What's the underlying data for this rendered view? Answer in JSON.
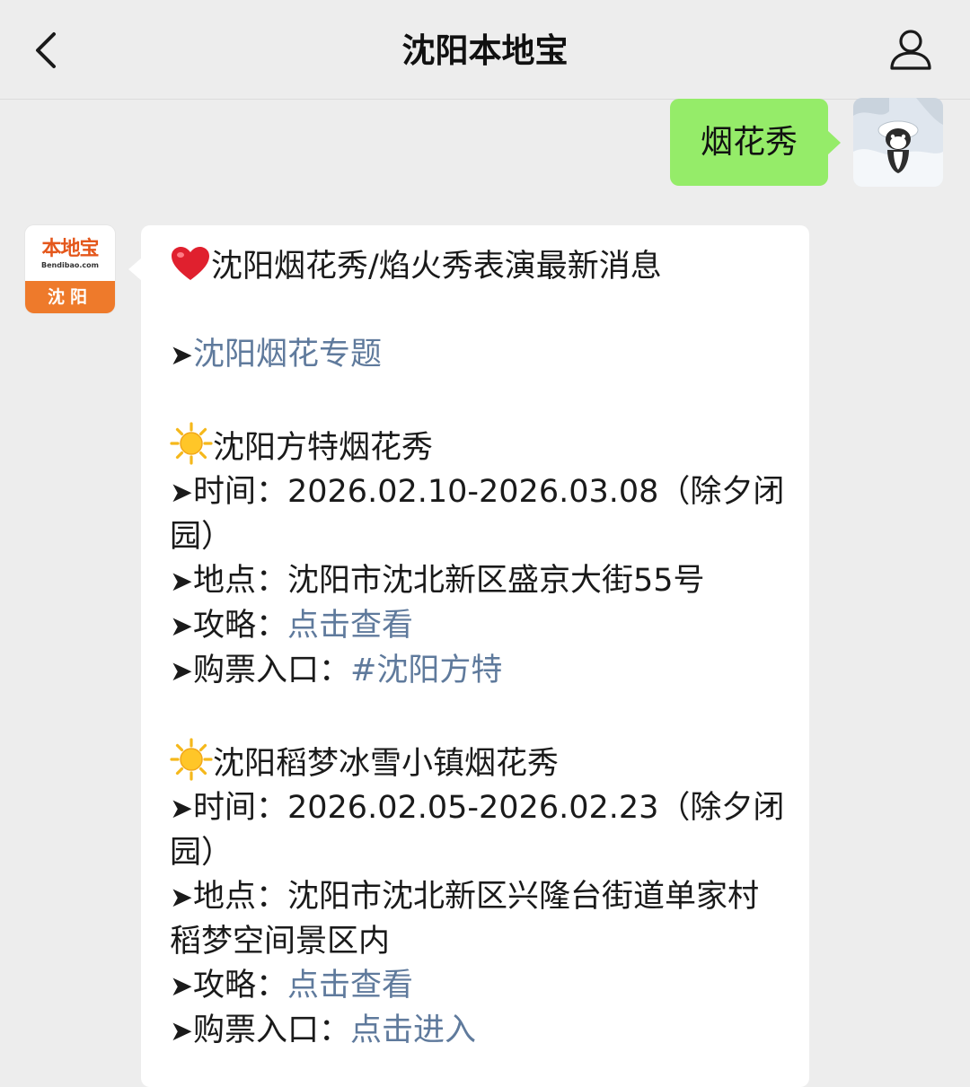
{
  "header": {
    "title": "沈阳本地宝"
  },
  "outgoing": {
    "text": "烟花秀"
  },
  "bot_avatar": {
    "brand": "本地宝",
    "domain": "Bendibao.com",
    "city": "沈阳"
  },
  "message": {
    "headline": "沈阳烟花秀/焰火秀表演最新消息",
    "arrow": "➤",
    "topic_link": "沈阳烟花专题",
    "events": [
      {
        "name": "沈阳方特烟花秀",
        "time_label": "时间：",
        "time_value": "2026.02.10-2026.03.08（除夕闭园）",
        "place_label": "地点：",
        "place_value": "沈阳市沈北新区盛京大街55号",
        "guide_label": "攻略：",
        "guide_link": "点击查看",
        "ticket_label": "购票入口：",
        "ticket_link": "#沈阳方特"
      },
      {
        "name": "沈阳稻梦冰雪小镇烟花秀",
        "time_label": "时间：",
        "time_value": "2026.02.05-2026.02.23（除夕闭园）",
        "place_label": "地点：",
        "place_value": "沈阳市沈北新区兴隆台街道单家村稻梦空间景区内",
        "guide_label": "攻略：",
        "guide_link": "点击查看",
        "ticket_label": "购票入口：",
        "ticket_link": "点击进入"
      }
    ]
  },
  "colors": {
    "background": "#ededed",
    "outgoing_bubble": "#95ec69",
    "incoming_bubble": "#ffffff",
    "link": "#5f7a9c",
    "logo_orange": "#ee7a2b"
  },
  "icons": {
    "back": "chevron-left-icon",
    "profile": "person-icon",
    "heart": "heart-icon",
    "sun": "sun-icon"
  }
}
